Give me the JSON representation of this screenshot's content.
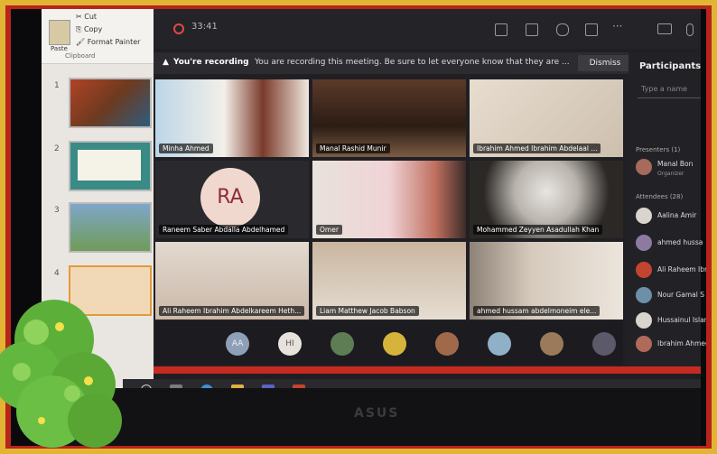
{
  "ppt": {
    "cut": "Cut",
    "copy": "Copy",
    "format_painter": "Format Painter",
    "paste": "Paste",
    "clipboard": "Clipboard",
    "slide_numbers": [
      "1",
      "2",
      "3",
      "4"
    ]
  },
  "meeting": {
    "timer": "33:41",
    "banner_title": "You're recording",
    "banner_text": "You are recording this meeting. Be sure to let everyone know that they are ...",
    "dismiss": "Dismiss"
  },
  "tiles": [
    {
      "name": "Minha Ahmed"
    },
    {
      "name": "Manal Rashid Munir"
    },
    {
      "name": "Ibrahim Ahmed Ibrahim Abdelaal ..."
    },
    {
      "name": "Raneem Saber Abdalla Abdelhamed",
      "initials": "RA"
    },
    {
      "name": "Omer"
    },
    {
      "name": "Mohammed Zeyyen Asadullah Khan"
    },
    {
      "name": "Ali Raheem Ibrahim Abdelkareem Heth..."
    },
    {
      "name": "Liam Matthew Jacob Babson"
    },
    {
      "name": "ahmed hussam abdelmoneim ele..."
    }
  ],
  "bottom_avatars": [
    "AA",
    "HI"
  ],
  "participants": {
    "title": "Participants",
    "search_placeholder": "Type a name",
    "presenters_label": "Presenters (1)",
    "attendees_label": "Attendees (28)",
    "presenter": {
      "name": "Manal Bon",
      "role": "Organizer"
    },
    "attendees": [
      "Aalina Amir",
      "ahmed hussa",
      "Ali Raheem Ibr",
      "Nour Gamal S",
      "Hussainul Islam",
      "Ibrahim Ahmed"
    ]
  },
  "monitor_brand": "ASUS",
  "colors": {
    "record": "#e04848",
    "ra_bg": "#f1d8cf",
    "ra_fg": "#8b2c39",
    "frame_red": "#b8251b",
    "frame_gold": "#e2b434"
  }
}
